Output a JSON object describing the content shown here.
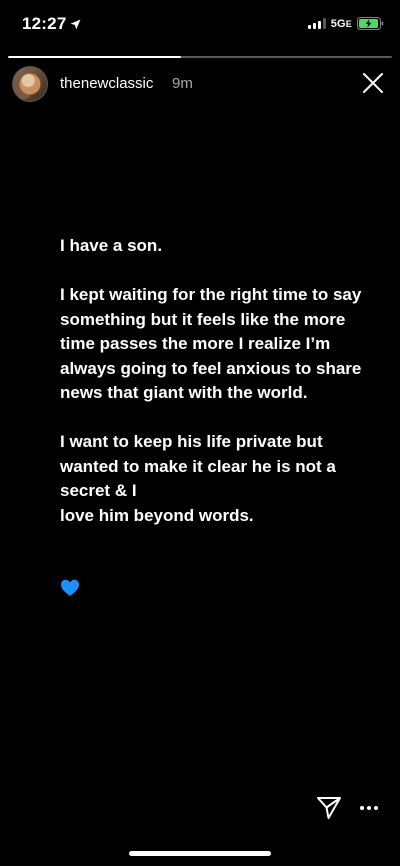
{
  "status_bar": {
    "time": "12:27",
    "network": "5G",
    "network_suffix": "E",
    "signal_bars": 3,
    "battery_level": 0.85,
    "battery_charging": true,
    "battery_color": "#4cd964"
  },
  "story": {
    "progress": 0.45,
    "username": "thenewclassic",
    "time_ago": "9m",
    "text": "I have a son.\n\nI kept waiting for the right time to say something but it feels like the more time passes the more I realize I’m always going to feel anxious to share news that giant with the world.\n\nI want to keep his life private but wanted to make it clear he is not a secret & I\nlove him beyond words.",
    "emoji": "blue-heart",
    "emoji_color": "#1e8fff"
  },
  "icons": {
    "close": "close-icon",
    "send": "send-icon",
    "more": "more-icon",
    "location": "location-arrow-icon"
  }
}
